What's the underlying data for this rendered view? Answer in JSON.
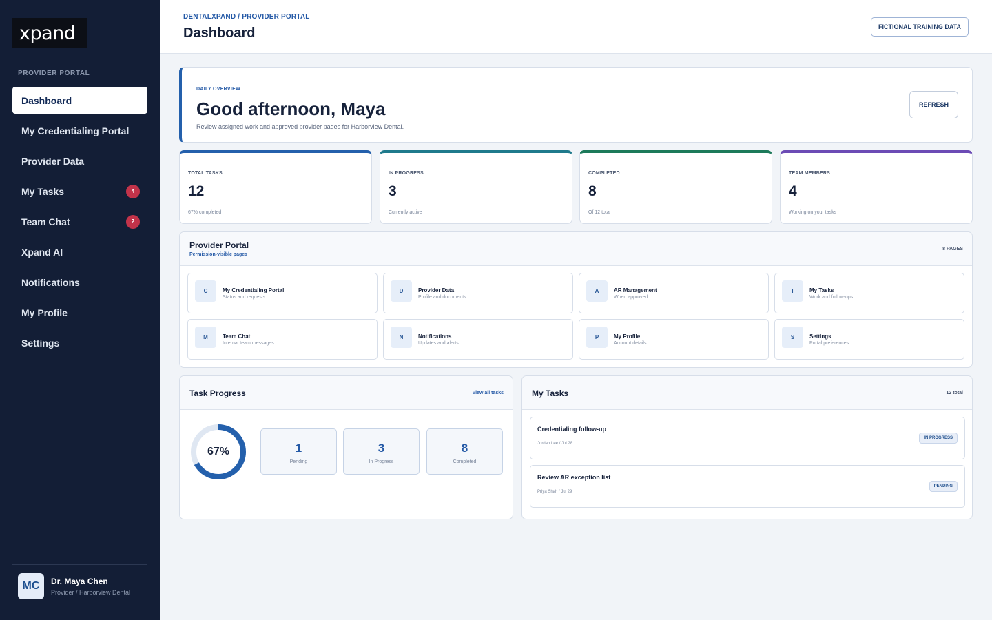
{
  "brand": {
    "logo_text": "xpand"
  },
  "sidebar": {
    "section_label": "PROVIDER PORTAL",
    "items": [
      {
        "label": "Dashboard",
        "active": true,
        "badge": ""
      },
      {
        "label": "My Credentialing Portal",
        "badge": ""
      },
      {
        "label": "Provider Data",
        "badge": ""
      },
      {
        "label": "My Tasks",
        "badge": "4"
      },
      {
        "label": "Team Chat",
        "badge": "2"
      },
      {
        "label": "Xpand AI",
        "badge": ""
      },
      {
        "label": "Notifications",
        "badge": ""
      },
      {
        "label": "My Profile",
        "badge": ""
      },
      {
        "label": "Settings",
        "badge": ""
      }
    ],
    "user": {
      "initials": "MC",
      "name": "Dr. Maya Chen",
      "role": "Provider / Harborview Dental"
    }
  },
  "header": {
    "breadcrumb": "DENTALXPAND / PROVIDER PORTAL",
    "title": "Dashboard",
    "tag_button": "FICTIONAL TRAINING DATA"
  },
  "overview": {
    "label": "DAILY OVERVIEW",
    "greeting": "Good afternoon, Maya",
    "subtitle": "Review assigned work and approved provider pages for Harborview Dental.",
    "refresh_label": "REFRESH"
  },
  "stats": [
    {
      "label": "TOTAL TASKS",
      "value": "12",
      "note": "67% completed",
      "color": "#2460ac"
    },
    {
      "label": "IN PROGRESS",
      "value": "3",
      "note": "Currently active",
      "color": "#1f7a8c"
    },
    {
      "label": "COMPLETED",
      "value": "8",
      "note": "Of 12 total",
      "color": "#1d7a5a"
    },
    {
      "label": "TEAM MEMBERS",
      "value": "4",
      "note": "Working on your tasks",
      "color": "#6c4bb5"
    }
  ],
  "portal": {
    "title": "Provider Portal",
    "subtitle": "Permission-visible pages",
    "count": "8 PAGES",
    "tiles": [
      {
        "letter": "C",
        "title": "My Credentialing Portal",
        "sub": "Status and requests"
      },
      {
        "letter": "D",
        "title": "Provider Data",
        "sub": "Profile and documents"
      },
      {
        "letter": "A",
        "title": "AR Management",
        "sub": "When approved"
      },
      {
        "letter": "T",
        "title": "My Tasks",
        "sub": "Work and follow-ups"
      },
      {
        "letter": "M",
        "title": "Team Chat",
        "sub": "Internal team messages"
      },
      {
        "letter": "N",
        "title": "Notifications",
        "sub": "Updates and alerts"
      },
      {
        "letter": "P",
        "title": "My Profile",
        "sub": "Account details"
      },
      {
        "letter": "S",
        "title": "Settings",
        "sub": "Portal preferences"
      }
    ]
  },
  "progress": {
    "title": "Task Progress",
    "link": "View all tasks",
    "percent_label": "67%",
    "percent": 67,
    "ring_color": "#2460ac",
    "ring_track": "#dfe7f2",
    "boxes": [
      {
        "value": "1",
        "label": "Pending"
      },
      {
        "value": "3",
        "label": "In Progress"
      },
      {
        "value": "8",
        "label": "Completed"
      }
    ]
  },
  "tasks": {
    "title": "My Tasks",
    "count": "12 total",
    "items": [
      {
        "title": "Credentialing follow-up",
        "meta": "Jordan Lee / Jul 28",
        "status": "IN PROGRESS"
      },
      {
        "title": "Review AR exception list",
        "meta": "Priya Shah / Jul 29",
        "status": "PENDING"
      }
    ]
  }
}
